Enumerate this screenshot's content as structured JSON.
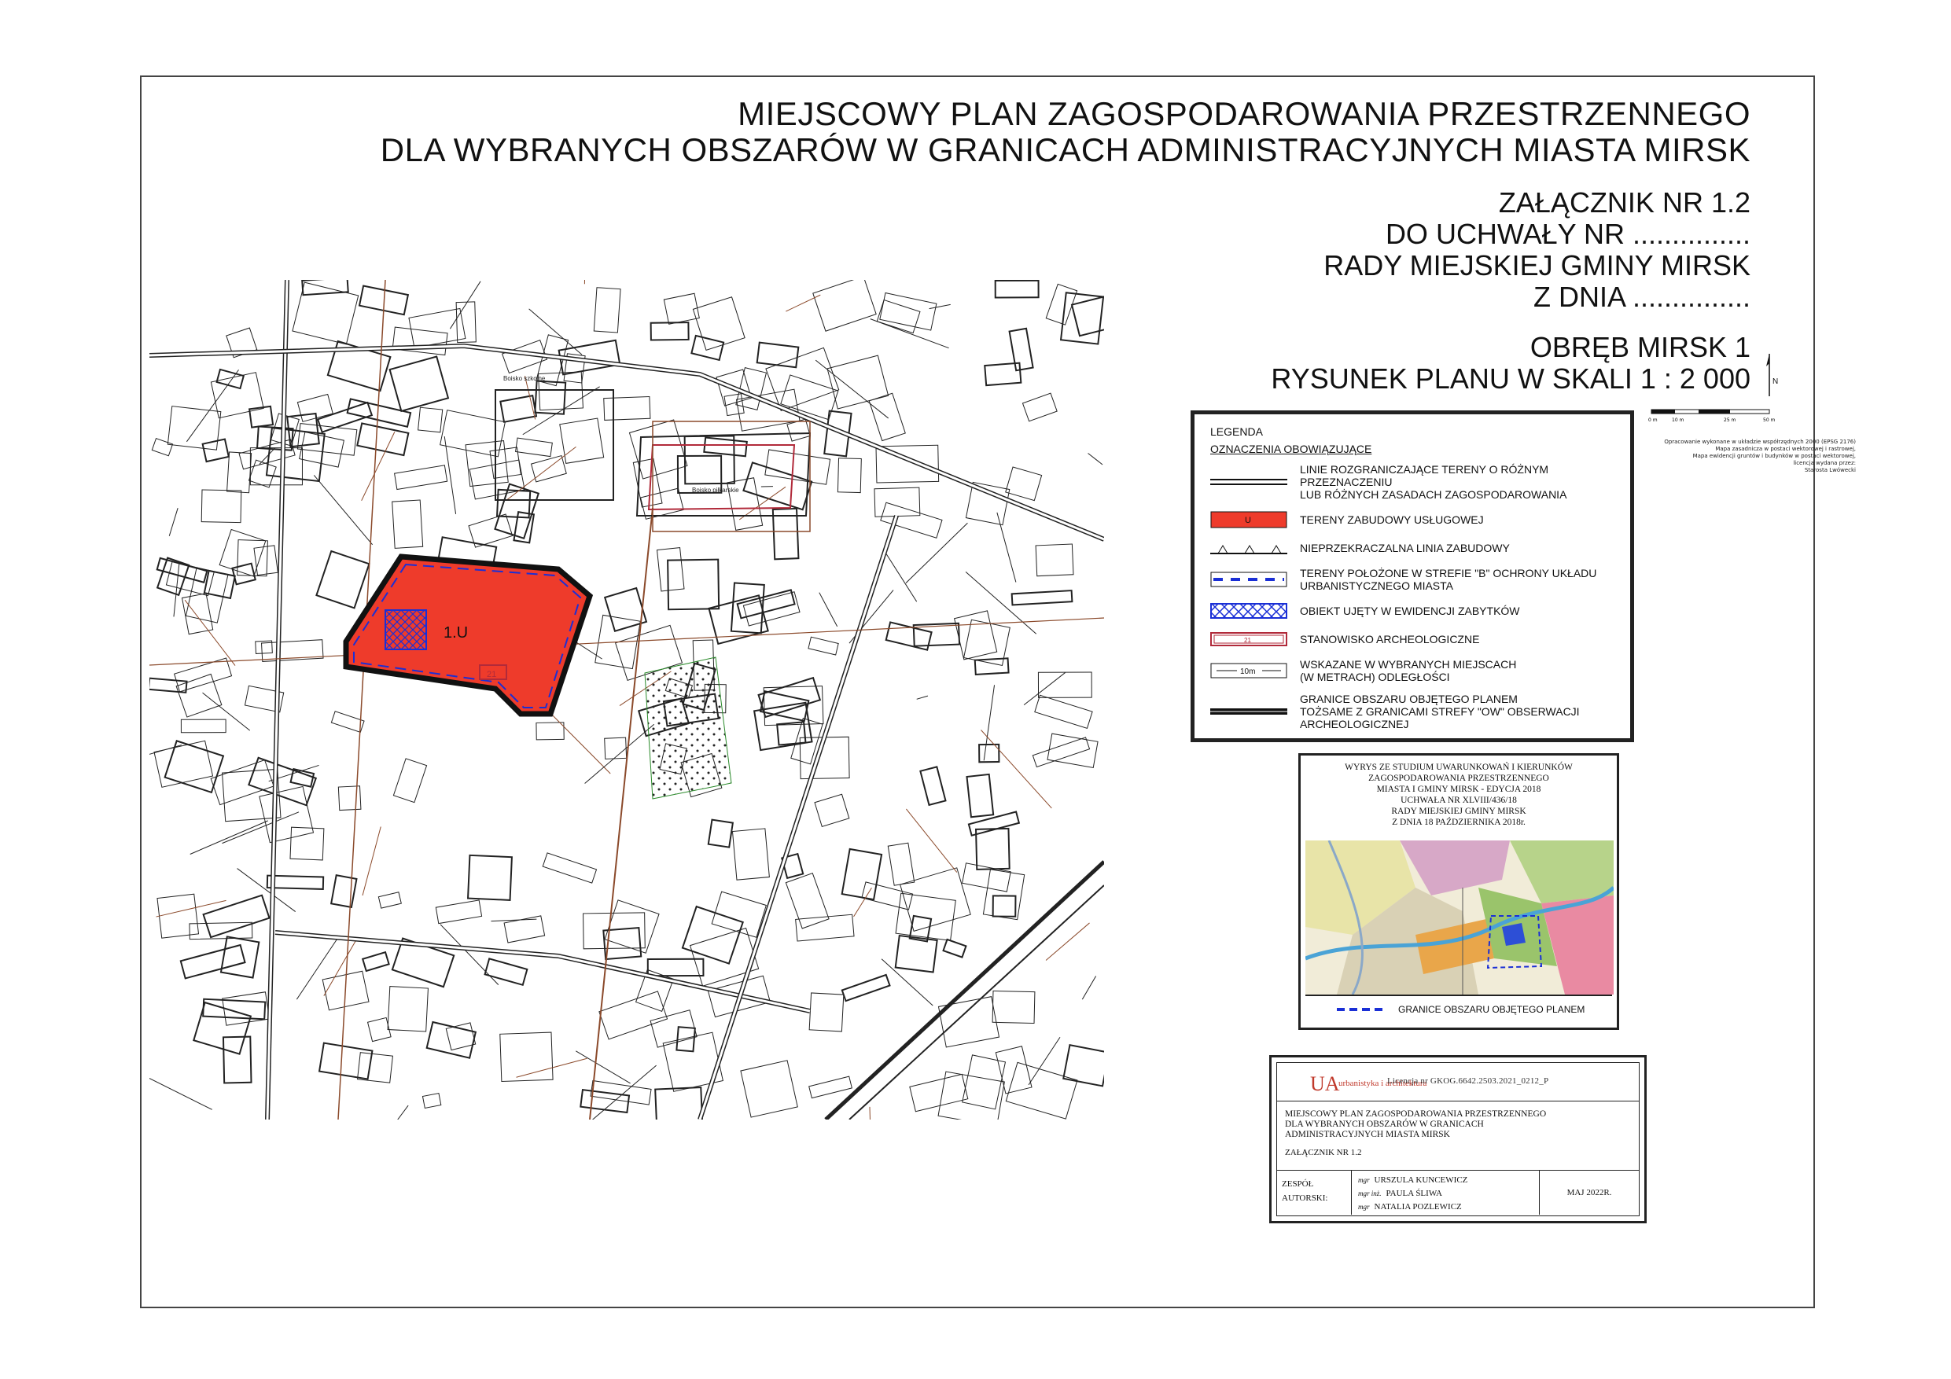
{
  "title": {
    "line1": "MIEJSCOWY PLAN ZAGOSPODAROWANIA PRZESTRZENNEGO",
    "line2": "DLA WYBRANYCH OBSZARÓW W GRANICACH ADMINISTRACYJNYCH MIASTA MIRSK",
    "zalacznik": "ZAŁĄCZNIK NR 1.2",
    "uchwala": "DO UCHWAŁY NR ...............",
    "rada": "RADY MIEJSKIEJ GMINY MIRSK",
    "dnia": "Z DNIA ...............",
    "obreb": "OBRĘB MIRSK 1",
    "skala": "RYSUNEK PLANU W SKALI 1 : 2 000"
  },
  "north_label": "N",
  "scale_labels": [
    "0 m",
    "10 m",
    "25 m",
    "50 m"
  ],
  "notes": [
    "Opracowanie wykonane w układzie współrzędnych 2000 (EPSG 2176)",
    "Mapa zasadnicza w postaci wektorowej i rastrowej,",
    "Mapa ewidencji gruntów i budynków w postaci wektorowej,",
    "licencja wydana przez:",
    "Starosta Lwówecki"
  ],
  "map": {
    "zone_label": "1.U",
    "site_code": "21",
    "building_labels": [
      "Boisko szkolne",
      "Boisko piłkarskie"
    ],
    "colors": {
      "service_fill": "#ee3b2b",
      "boundary": "#111111",
      "zone_b": "#1a2fd6",
      "archaeo": "#b12a3a",
      "road": "#8b4a2b"
    }
  },
  "legend": {
    "title": "LEGENDA",
    "section": "OZNACZENIA OBOWIĄZUJĄCE",
    "items": [
      {
        "symbol": "double-line",
        "text": "LINIE ROZGRANICZAJĄCE TERENY O RÓŻNYM PRZEZNACZENIU\nLUB RÓŻNYCH ZASADACH ZAGOSPODAROWANIA"
      },
      {
        "symbol": "red-fill",
        "code": "U",
        "text": "TERENY ZABUDOWY USŁUGOWEJ"
      },
      {
        "symbol": "triangles",
        "text": "NIEPRZEKRACZALNA LINIA ZABUDOWY"
      },
      {
        "symbol": "blue-zone",
        "text": "TERENY POŁOŻONE W STREFIE \"B\" OCHRONY UKŁADU\nURBANISTYCZNEGO MIASTA"
      },
      {
        "symbol": "blue-hatch",
        "text": "OBIEKT UJĘTY W EWIDENCJI ZABYTKÓW"
      },
      {
        "symbol": "archaeo-rect",
        "code": "21",
        "text": "STANOWISKO ARCHEOLOGICZNE"
      },
      {
        "symbol": "dimension",
        "code": "10m",
        "text": "WSKAZANE W WYBRANYCH MIEJSCACH\n(W METRACH) ODLEGŁOŚCI"
      },
      {
        "symbol": "boundary-thick",
        "text": "GRANICE OBSZARU OBJĘTEGO PLANEM\nTOŻSAME Z GRANICAMI STREFY \"OW\" OBSERWACJI ARCHEOLOGICZNEJ"
      }
    ]
  },
  "studium": {
    "lines": [
      "WYRYS ZE STUDIUM UWARUNKOWAŃ I KIERUNKÓW",
      "ZAGOSPODAROWANIA PRZESTRZENNEGO",
      "MIASTA I GMINY MIRSK - EDYCJA 2018",
      "UCHWAŁA NR XLVIII/436/18",
      "RADY MIEJSKIEJ GMINY MIRSK",
      "Z DNIA 18 PAŹDZIERNIKA 2018r."
    ],
    "footer": "GRANICE OBSZARU OBJĘTEGO PLANEM"
  },
  "stamp": {
    "logo": "UA",
    "firm": "urbanistyka i architektura",
    "doc_code": "Licencja nr GKOG.6642.2503.2021_0212_P",
    "desc_lines": [
      "MIEJSCOWY PLAN ZAGOSPODAROWANIA PRZESTRZENNEGO",
      "DLA WYBRANYCH OBSZARÓW W GRANICACH",
      "ADMINISTRACYJNYCH MIASTA MIRSK"
    ],
    "zalacznik": "ZAŁĄCZNIK NR 1.2",
    "team_label_1": "ZESPÓŁ",
    "team_label_2": "AUTORSKI:",
    "authors": [
      {
        "prefix": "mgr",
        "name": "URSZULA KUNCEWICZ"
      },
      {
        "prefix": "mgr inż.",
        "name": "PAULA ŚLIWA"
      },
      {
        "prefix": "mgr",
        "name": "NATALIA POZLEWICZ"
      }
    ],
    "date": "MAJ 2022R."
  }
}
